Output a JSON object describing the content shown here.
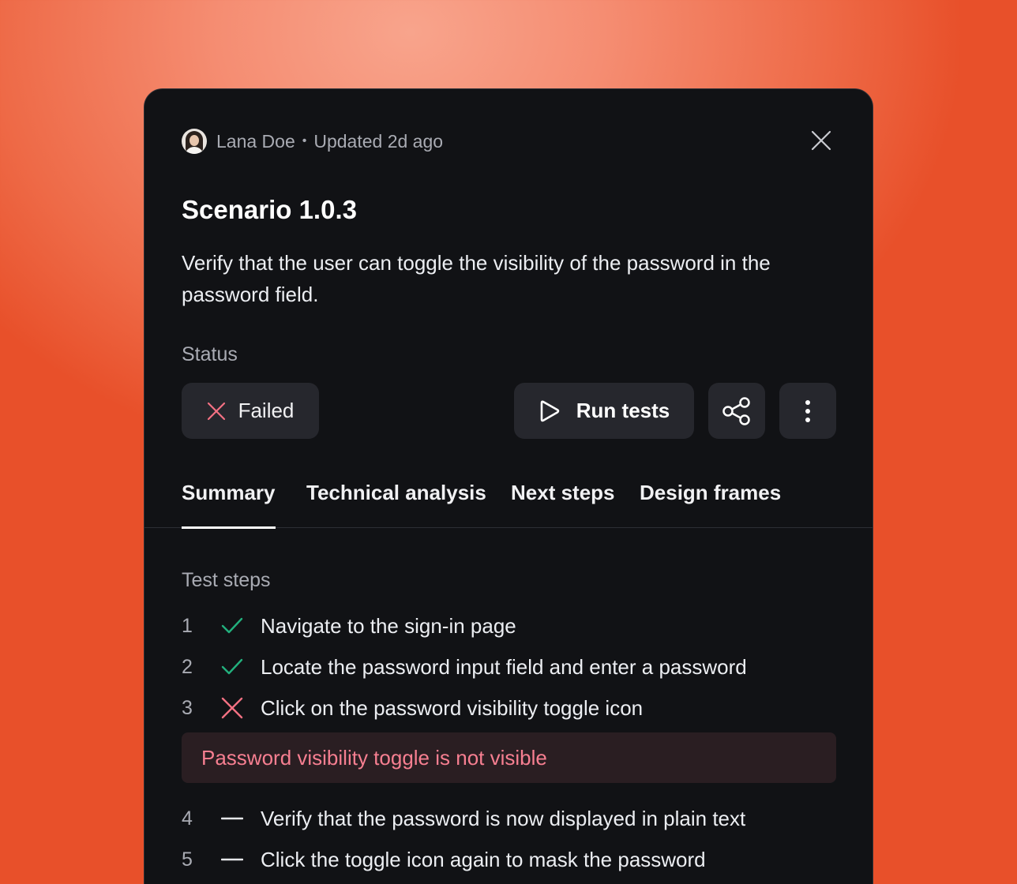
{
  "header": {
    "author": "Lana Doe",
    "separator": "•",
    "updated": "Updated 2d ago"
  },
  "scenario": {
    "title": "Scenario 1.0.3",
    "description": "Verify that the user can toggle the visibility of the password in the password field."
  },
  "status": {
    "label": "Status",
    "value": "Failed"
  },
  "actions": {
    "run_tests": "Run tests"
  },
  "tabs": [
    {
      "label": "Summary",
      "active": true
    },
    {
      "label": "Technical analysis",
      "active": false
    },
    {
      "label": "Next steps",
      "active": false
    },
    {
      "label": "Design frames",
      "active": false
    }
  ],
  "steps_label": "Test steps",
  "steps": [
    {
      "num": "1",
      "state": "passed",
      "text": "Navigate to the sign-in page"
    },
    {
      "num": "2",
      "state": "passed",
      "text": "Locate the password input field and enter a password"
    },
    {
      "num": "3",
      "state": "failed",
      "text": "Click on the password visibility toggle icon"
    },
    {
      "num": "4",
      "state": "pending",
      "text": "Verify that the password is now displayed in plain text"
    },
    {
      "num": "5",
      "state": "pending",
      "text": "Click the toggle icon again to mask the password"
    }
  ],
  "error": "Password visibility toggle is not visible",
  "colors": {
    "accent_pass": "#22b07d",
    "accent_fail": "#f47183",
    "panel_bg": "#111215",
    "button_bg": "#26272d"
  },
  "icons": [
    "avatar",
    "close-icon",
    "x-icon",
    "play-icon",
    "share-icon",
    "more-vertical-icon",
    "check-icon",
    "dash-icon"
  ]
}
